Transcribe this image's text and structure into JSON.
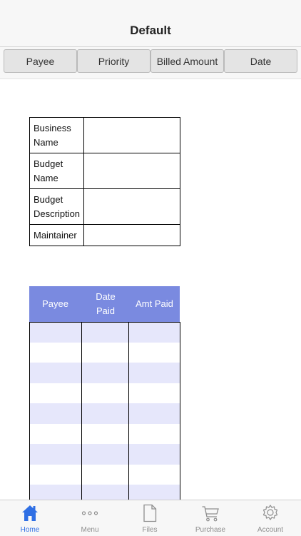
{
  "nav": {
    "title": "Default"
  },
  "sort_buttons": [
    {
      "label": "Payee"
    },
    {
      "label": "Priority"
    },
    {
      "label": "Billed Amount"
    },
    {
      "label": "Date"
    }
  ],
  "info_table": {
    "rows": [
      {
        "label": "Business Name",
        "value": ""
      },
      {
        "label": "Budget Name",
        "value": ""
      },
      {
        "label": "Budget Description",
        "value": ""
      },
      {
        "label": "Maintainer",
        "value": ""
      }
    ]
  },
  "payments_table": {
    "columns": [
      "Payee",
      "Date Paid",
      "Amt Paid"
    ],
    "header_color": "#7a8ae0",
    "stripe_color": "#e6e7fb"
  },
  "tabbar": {
    "active_color": "#2f6fe4",
    "items": [
      {
        "label": "Home",
        "icon": "home-icon"
      },
      {
        "label": "Menu",
        "icon": "more-dots-icon"
      },
      {
        "label": "Files",
        "icon": "document-icon"
      },
      {
        "label": "Purchase",
        "icon": "cart-icon"
      },
      {
        "label": "Account",
        "icon": "gear-icon"
      }
    ]
  }
}
